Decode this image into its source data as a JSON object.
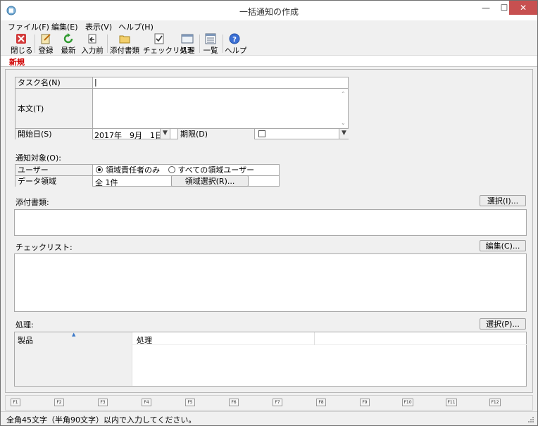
{
  "window": {
    "title": "一括通知の作成",
    "min_glyph": "—",
    "max_glyph": "☐",
    "close_glyph": "✕"
  },
  "menu": [
    {
      "label": "ファイル(F)"
    },
    {
      "label": "編集(E)"
    },
    {
      "label": "表示(V)"
    },
    {
      "label": "ヘルプ(H)"
    }
  ],
  "toolbar": {
    "close": "閉じる",
    "register": "登録",
    "refresh": "最新",
    "prev_input": "入力前",
    "attachments": "添付書類",
    "checklist": "チェックリスト",
    "process": "処理",
    "list": "一覧",
    "help": "ヘルプ"
  },
  "tab": {
    "label": "新規"
  },
  "form": {
    "task_name_label": "タスク名(N)",
    "task_name_value": "|",
    "body_label": "本文(T)",
    "start_date_label": "開始日(S)",
    "start_date_value": "2017年　9月　1日",
    "due_label": "期限(D)",
    "target_label": "通知対象(O):",
    "user_label": "ユーザー",
    "radio_manager": "領域責任者のみ",
    "radio_all": "すべての領域ユーザー",
    "data_area_label": "データ領域",
    "data_area_value": "全 1件",
    "area_select_button": "領域選択(R)...",
    "attachments_label": "添付書類:",
    "attachments_button": "選択(I)...",
    "checklist_label": "チェックリスト:",
    "checklist_button": "編集(C)...",
    "process_label": "処理:",
    "process_button": "選択(P)...",
    "col_product": "製品",
    "col_process": "処理"
  },
  "fkeys": [
    "F1",
    "F2",
    "F3",
    "F4",
    "F5",
    "F6",
    "F7",
    "F8",
    "F9",
    "F10",
    "F11",
    "F12"
  ],
  "status": {
    "text": "全角45文字（半角90文字）以内で入力してください。"
  }
}
